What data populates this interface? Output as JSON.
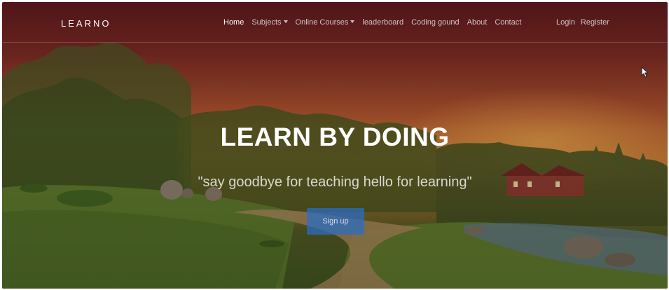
{
  "brand": {
    "name": "LEARNO"
  },
  "nav": {
    "items": [
      {
        "label": "Home",
        "active": true,
        "dropdown": false
      },
      {
        "label": "Subjects",
        "active": false,
        "dropdown": true
      },
      {
        "label": "Online Courses",
        "active": false,
        "dropdown": true
      },
      {
        "label": "leaderboard",
        "active": false,
        "dropdown": false
      },
      {
        "label": "Coding gound",
        "active": false,
        "dropdown": false
      },
      {
        "label": "About",
        "active": false,
        "dropdown": false
      },
      {
        "label": "Contact",
        "active": false,
        "dropdown": false
      }
    ],
    "auth": [
      {
        "label": "Login"
      },
      {
        "label": "Register"
      }
    ]
  },
  "hero": {
    "title": "LEARN BY DOING",
    "subtitle": "\"say goodbye for teaching hello for learning\"",
    "button_label": "Sign up"
  },
  "colors": {
    "button_accent": "#286ec8",
    "text_white": "#ffffff"
  },
  "icons": {
    "cursor": "arrow-cursor-icon"
  }
}
